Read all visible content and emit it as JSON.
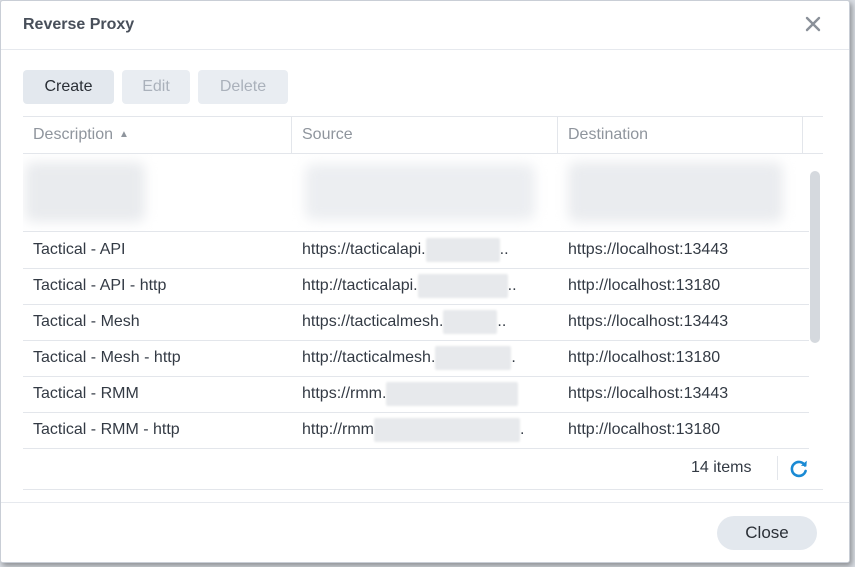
{
  "dialog": {
    "title": "Reverse Proxy"
  },
  "toolbar": {
    "create": "Create",
    "edit": "Edit",
    "delete": "Delete"
  },
  "table": {
    "columns": {
      "description": "Description",
      "source": "Source",
      "destination": "Destination"
    },
    "rows": [
      {
        "description": "Tactical - API",
        "source": "https://tacticalapi.",
        "source_tail": "..",
        "destination": "https://localhost:13443"
      },
      {
        "description": "Tactical - API - http",
        "source": "http://tacticalapi.",
        "source_tail": "..",
        "destination": "http://localhost:13180"
      },
      {
        "description": "Tactical - Mesh",
        "source": "https://tacticalmesh.",
        "source_tail": "..",
        "destination": "https://localhost:13443"
      },
      {
        "description": "Tactical - Mesh - http",
        "source": "http://tacticalmesh.",
        "source_tail": ".",
        "destination": "http://localhost:13180"
      },
      {
        "description": "Tactical - RMM",
        "source": "https://rmm.",
        "source_tail": "",
        "destination": "https://localhost:13443"
      },
      {
        "description": "Tactical - RMM - http",
        "source": "http://rmm",
        "source_tail": ".",
        "destination": "http://localhost:13180"
      }
    ],
    "count": "14 items"
  },
  "footer": {
    "close": "Close"
  },
  "colors": {
    "accent": "#1a8ad4",
    "button_bg": "#e3e8ee"
  }
}
